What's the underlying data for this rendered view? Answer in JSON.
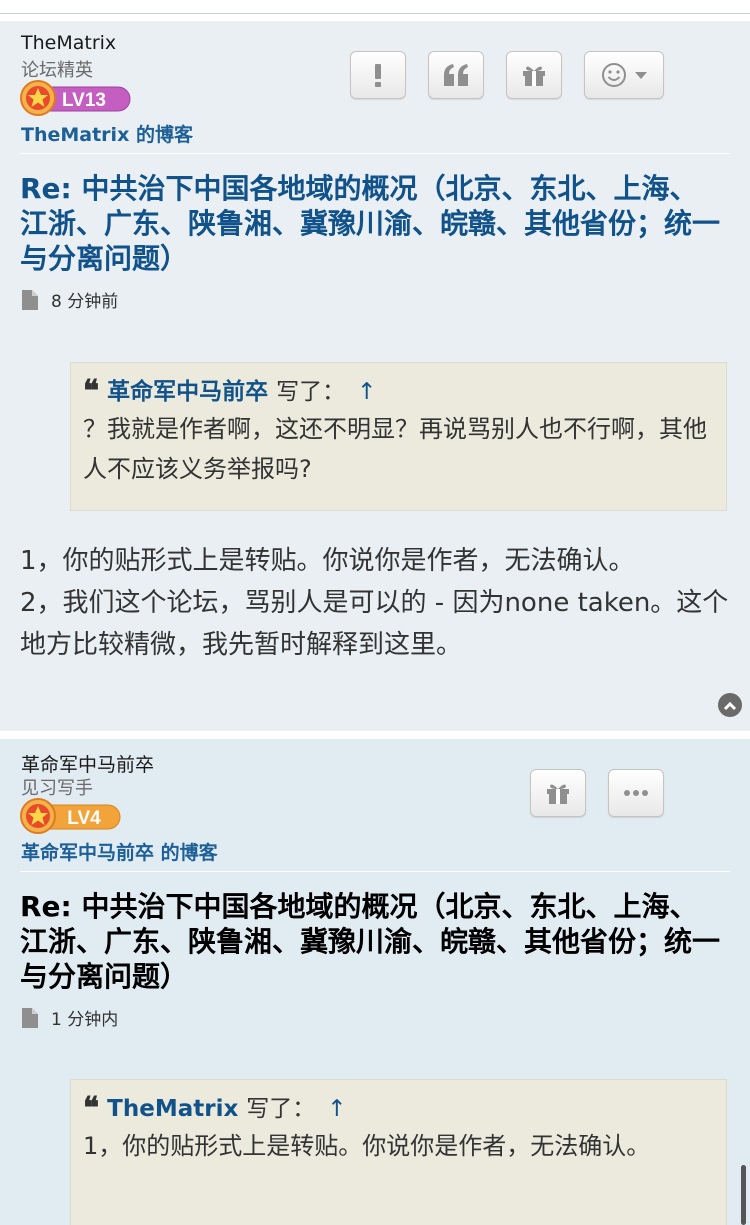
{
  "posts": [
    {
      "author": "TheMatrix",
      "rank": "论坛精英",
      "level": "LV13",
      "blog": {
        "name": "TheMatrix",
        "suffix": " 的博客"
      },
      "title": "Re: 中共治下中国各地域的概况（北京、东北、上海、江浙、广东、陕鲁湘、冀豫川渝、皖赣、其他省份；统一与分离问题）",
      "time": "8 分钟前",
      "quote": {
        "author": "革命军中马前卒",
        "wrote": "写了：",
        "arrow": "↑",
        "text": "？我就是作者啊，这还不明显？再说骂别人也不行啊，其他人不应该义务举报吗?"
      },
      "content_lines": [
        "1，你的贴形式上是转贴。你说你是作者，无法确认。",
        "2，我们这个论坛，骂别人是可以的 - 因为none taken。这个地方比较精微，我先暂时解释到这里。"
      ],
      "buttons": [
        "report-icon",
        "quote-icon",
        "gift-icon",
        "emoji-dropdown-icon"
      ]
    },
    {
      "author": "革命军中马前卒",
      "rank": "见习写手",
      "level": "LV4",
      "blog": {
        "name": "革命军中马前卒",
        "suffix": " 的博客"
      },
      "title": "Re: 中共治下中国各地域的概况（北京、东北、上海、江浙、广东、陕鲁湘、冀豫川渝、皖赣、其他省份；统一与分离问题）",
      "time": "1 分钟内",
      "quote": {
        "author": "TheMatrix",
        "wrote": "写了：",
        "arrow": "↑",
        "text": "1，你的贴形式上是转贴。你说你是作者，无法确认。"
      },
      "buttons": [
        "gift-icon",
        "more-icon"
      ]
    }
  ],
  "colors": {
    "link": "#105289",
    "post_bg_1": "#e9eff3",
    "post_bg_2": "#e1ebf2",
    "quote_bg": "#ebeadd",
    "badge_lv13": "#c45ec0",
    "badge_lv4": "#f2a33a"
  }
}
